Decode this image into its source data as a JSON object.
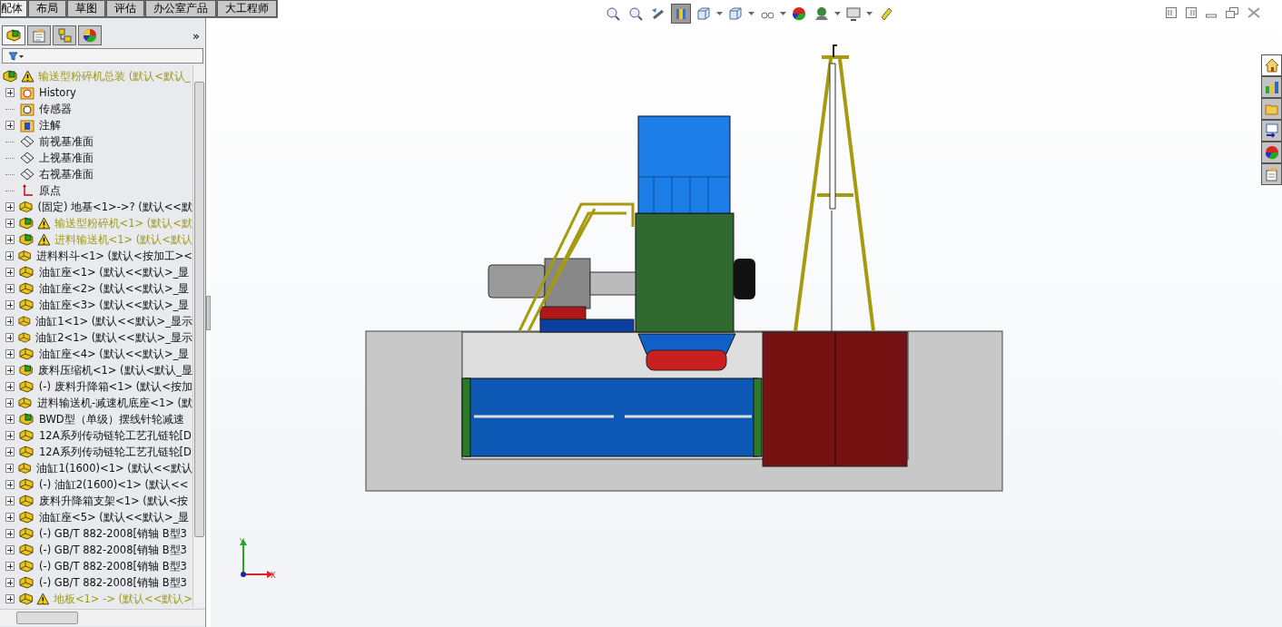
{
  "tabs": [
    {
      "label": "配体",
      "selected": true
    },
    {
      "label": "布局",
      "selected": false
    },
    {
      "label": "草图",
      "selected": false
    },
    {
      "label": "评估",
      "selected": false
    },
    {
      "label": "办公室产品",
      "selected": false
    },
    {
      "label": "大工程师",
      "selected": false
    }
  ],
  "panel_tabs": [
    {
      "kind": "tree",
      "selected": true
    },
    {
      "kind": "property",
      "selected": false
    },
    {
      "kind": "config",
      "selected": false
    },
    {
      "kind": "display",
      "selected": false
    }
  ],
  "panel_more": "»",
  "tree": {
    "root": {
      "label": "输送型粉碎机总装  (默认<默认_",
      "warning": true
    },
    "items": [
      {
        "label": "History",
        "kind": "history",
        "expandable": true,
        "warning": false
      },
      {
        "label": "传感器",
        "kind": "sensor",
        "expandable": false,
        "warning": false
      },
      {
        "label": "注解",
        "kind": "annotation",
        "expandable": true,
        "warning": false
      },
      {
        "label": "前视基准面",
        "kind": "plane",
        "expandable": false,
        "warning": false
      },
      {
        "label": "上视基准面",
        "kind": "plane",
        "expandable": false,
        "warning": false
      },
      {
        "label": "右视基准面",
        "kind": "plane",
        "expandable": false,
        "warning": false
      },
      {
        "label": "原点",
        "kind": "origin",
        "expandable": false,
        "warning": false
      },
      {
        "label": "(固定) 地基<1>->? (默认<<默",
        "kind": "part",
        "expandable": true,
        "warning": false
      },
      {
        "label": "输送型粉碎机<1> (默认<默",
        "kind": "assembly",
        "expandable": true,
        "warning": true
      },
      {
        "label": "进料输送机<1> (默认<默认",
        "kind": "assembly",
        "expandable": true,
        "warning": true
      },
      {
        "label": "进料料斗<1> (默认<按加工><",
        "kind": "part",
        "expandable": true,
        "warning": false
      },
      {
        "label": "油缸座<1> (默认<<默认>_显",
        "kind": "part",
        "expandable": true,
        "warning": false
      },
      {
        "label": "油缸座<2> (默认<<默认>_显",
        "kind": "part",
        "expandable": true,
        "warning": false
      },
      {
        "label": "油缸座<3> (默认<<默认>_显",
        "kind": "part",
        "expandable": true,
        "warning": false
      },
      {
        "label": "油缸1<1> (默认<<默认>_显示",
        "kind": "part",
        "expandable": true,
        "warning": false
      },
      {
        "label": "油缸2<1> (默认<<默认>_显示",
        "kind": "part",
        "expandable": true,
        "warning": false
      },
      {
        "label": "油缸座<4> (默认<<默认>_显",
        "kind": "part",
        "expandable": true,
        "warning": false
      },
      {
        "label": "废料压缩机<1> (默认<默认_显",
        "kind": "assembly",
        "expandable": true,
        "warning": false
      },
      {
        "label": "(-) 废料升降箱<1> (默认<按加",
        "kind": "part",
        "expandable": true,
        "warning": false
      },
      {
        "label": "进料输送机-减速机底座<1> (默",
        "kind": "part",
        "expandable": true,
        "warning": false
      },
      {
        "label": "BWD型（单级）摆线针轮减速",
        "kind": "assembly",
        "expandable": true,
        "warning": false
      },
      {
        "label": "12A系列传动链轮工艺孔链轮[D",
        "kind": "part",
        "expandable": true,
        "warning": false
      },
      {
        "label": "12A系列传动链轮工艺孔链轮[D",
        "kind": "part",
        "expandable": true,
        "warning": false
      },
      {
        "label": "油缸1(1600)<1> (默认<<默认",
        "kind": "part",
        "expandable": true,
        "warning": false
      },
      {
        "label": "(-) 油缸2(1600)<1> (默认<<",
        "kind": "part",
        "expandable": true,
        "warning": false
      },
      {
        "label": "废料升降箱支架<1> (默认<按",
        "kind": "part",
        "expandable": true,
        "warning": false
      },
      {
        "label": "油缸座<5> (默认<<默认>_显",
        "kind": "part",
        "expandable": true,
        "warning": false
      },
      {
        "label": "(-) GB/T 882-2008[销轴 B型3",
        "kind": "part",
        "expandable": true,
        "warning": false
      },
      {
        "label": "(-) GB/T 882-2008[销轴 B型3",
        "kind": "part",
        "expandable": true,
        "warning": false
      },
      {
        "label": "(-) GB/T 882-2008[销轴 B型3",
        "kind": "part",
        "expandable": true,
        "warning": false
      },
      {
        "label": "(-) GB/T 882-2008[销轴 B型3",
        "kind": "part",
        "expandable": true,
        "warning": false
      },
      {
        "label": "地板<1> -> (默认<<默认>",
        "kind": "part",
        "expandable": true,
        "warning": true
      }
    ]
  },
  "view_toolbar": [
    {
      "kind": "zoom-fit",
      "selected": false
    },
    {
      "kind": "zoom-area",
      "selected": false
    },
    {
      "kind": "previous",
      "selected": false
    },
    {
      "kind": "section",
      "selected": true
    },
    {
      "kind": "orientation",
      "selected": false
    },
    {
      "kind": "display-style",
      "selected": false
    },
    {
      "kind": "hide-show",
      "selected": false
    },
    {
      "kind": "appearance",
      "selected": false
    },
    {
      "kind": "scene",
      "selected": false
    },
    {
      "kind": "view-settings",
      "selected": false
    },
    {
      "kind": "realview",
      "selected": false
    }
  ],
  "task_pane": [
    {
      "kind": "home",
      "selected": true
    },
    {
      "kind": "library",
      "selected": false
    },
    {
      "kind": "folder",
      "selected": false
    },
    {
      "kind": "palette",
      "selected": false
    },
    {
      "kind": "appearances",
      "selected": false
    },
    {
      "kind": "properties",
      "selected": false
    }
  ],
  "triad": {
    "x_label": "X",
    "y_label": "Y"
  }
}
